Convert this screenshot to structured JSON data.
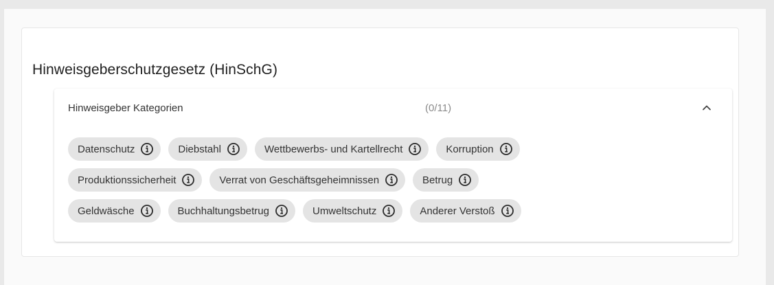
{
  "card": {
    "title": "Hinweisgeberschutzgesetz (HinSchG)"
  },
  "panel": {
    "label": "Hinweisgeber Kategorien",
    "count": "(0/11)",
    "expanded": true,
    "toggle_icon": "chevron-up-icon"
  },
  "chip_icon": "info-icon",
  "categories": [
    [
      "Datenschutz",
      "Diebstahl",
      "Wettbewerbs- und Kartellrecht",
      "Korruption"
    ],
    [
      "Produktionssicherheit",
      "Verrat von Geschäftsgeheimnissen",
      "Betrug"
    ],
    [
      "Geldwäsche",
      "Buchhaltungsbetrug",
      "Umweltschutz",
      "Anderer Verstoß"
    ]
  ],
  "colors": {
    "page_background": "#e9e9e9",
    "chip_background": "#e4e4e4",
    "text": "#333333",
    "muted_text": "#8a8a8a"
  }
}
